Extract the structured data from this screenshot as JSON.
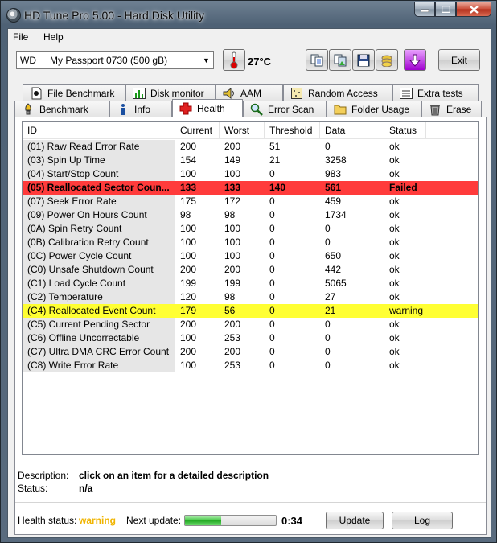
{
  "window": {
    "title": "HD Tune Pro 5.00 - Hard Disk Utility"
  },
  "menu": {
    "file": "File",
    "help": "Help"
  },
  "toolbar": {
    "drive_maker": "WD",
    "drive_model": "My Passport 0730 (500 gB)",
    "temperature": "27°C",
    "exit_label": "Exit"
  },
  "tabs_top": [
    {
      "label": "File Benchmark",
      "icon": "file-benchmark-icon"
    },
    {
      "label": "Disk monitor",
      "icon": "disk-monitor-icon"
    },
    {
      "label": "AAM",
      "icon": "speaker-icon"
    },
    {
      "label": "Random Access",
      "icon": "random-access-icon"
    },
    {
      "label": "Extra tests",
      "icon": "extra-tests-icon"
    }
  ],
  "tabs_bottom": [
    {
      "label": "Benchmark",
      "icon": "benchmark-icon"
    },
    {
      "label": "Info",
      "icon": "info-icon"
    },
    {
      "label": "Health",
      "icon": "health-cross-icon",
      "active": true
    },
    {
      "label": "Error Scan",
      "icon": "magnifier-icon"
    },
    {
      "label": "Folder Usage",
      "icon": "folder-icon"
    },
    {
      "label": "Erase",
      "icon": "trash-icon"
    }
  ],
  "table": {
    "headers": [
      "ID",
      "Current",
      "Worst",
      "Threshold",
      "Data",
      "Status"
    ],
    "rows": [
      {
        "id": "(01) Raw Read Error Rate",
        "current": "200",
        "worst": "200",
        "threshold": "51",
        "data": "0",
        "status": "ok",
        "state": "ok"
      },
      {
        "id": "(03) Spin Up Time",
        "current": "154",
        "worst": "149",
        "threshold": "21",
        "data": "3258",
        "status": "ok",
        "state": "ok"
      },
      {
        "id": "(04) Start/Stop Count",
        "current": "100",
        "worst": "100",
        "threshold": "0",
        "data": "983",
        "status": "ok",
        "state": "ok"
      },
      {
        "id": "(05) Reallocated Sector Coun...",
        "current": "133",
        "worst": "133",
        "threshold": "140",
        "data": "561",
        "status": "Failed",
        "state": "failed"
      },
      {
        "id": "(07) Seek Error Rate",
        "current": "175",
        "worst": "172",
        "threshold": "0",
        "data": "459",
        "status": "ok",
        "state": "ok"
      },
      {
        "id": "(09) Power On Hours Count",
        "current": "98",
        "worst": "98",
        "threshold": "0",
        "data": "1734",
        "status": "ok",
        "state": "ok"
      },
      {
        "id": "(0A) Spin Retry Count",
        "current": "100",
        "worst": "100",
        "threshold": "0",
        "data": "0",
        "status": "ok",
        "state": "ok"
      },
      {
        "id": "(0B) Calibration Retry Count",
        "current": "100",
        "worst": "100",
        "threshold": "0",
        "data": "0",
        "status": "ok",
        "state": "ok"
      },
      {
        "id": "(0C) Power Cycle Count",
        "current": "100",
        "worst": "100",
        "threshold": "0",
        "data": "650",
        "status": "ok",
        "state": "ok"
      },
      {
        "id": "(C0) Unsafe Shutdown Count",
        "current": "200",
        "worst": "200",
        "threshold": "0",
        "data": "442",
        "status": "ok",
        "state": "ok"
      },
      {
        "id": "(C1) Load Cycle Count",
        "current": "199",
        "worst": "199",
        "threshold": "0",
        "data": "5065",
        "status": "ok",
        "state": "ok"
      },
      {
        "id": "(C2) Temperature",
        "current": "120",
        "worst": "98",
        "threshold": "0",
        "data": "27",
        "status": "ok",
        "state": "ok"
      },
      {
        "id": "(C4) Reallocated Event Count",
        "current": "179",
        "worst": "56",
        "threshold": "0",
        "data": "21",
        "status": "warning",
        "state": "warning"
      },
      {
        "id": "(C5) Current Pending Sector",
        "current": "200",
        "worst": "200",
        "threshold": "0",
        "data": "0",
        "status": "ok",
        "state": "ok"
      },
      {
        "id": "(C6) Offline Uncorrectable",
        "current": "100",
        "worst": "253",
        "threshold": "0",
        "data": "0",
        "status": "ok",
        "state": "ok"
      },
      {
        "id": "(C7) Ultra DMA CRC Error Count",
        "current": "200",
        "worst": "200",
        "threshold": "0",
        "data": "0",
        "status": "ok",
        "state": "ok"
      },
      {
        "id": "(C8) Write Error Rate",
        "current": "100",
        "worst": "253",
        "threshold": "0",
        "data": "0",
        "status": "ok",
        "state": "ok"
      }
    ]
  },
  "description": {
    "label": "Description:",
    "value": "click on an item for a detailed description",
    "status_label": "Status:",
    "status_value": "n/a"
  },
  "footer": {
    "health_label": "Health status:",
    "health_value": "warning",
    "next_update_label": "Next update:",
    "progress_fraction": 0.4,
    "countdown": "0:34",
    "update_label": "Update",
    "log_label": "Log"
  },
  "colors": {
    "failed_row": "#ff3b3b",
    "warning_row": "#ffff33",
    "warning_text": "#f0b400"
  }
}
